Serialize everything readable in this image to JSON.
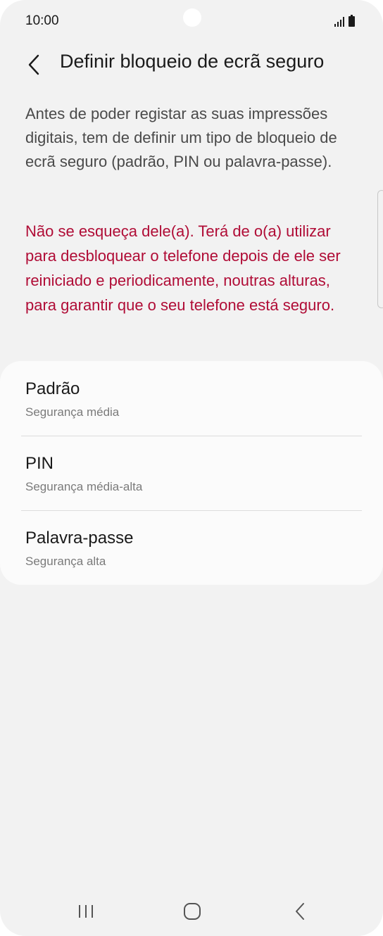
{
  "status_bar": {
    "time": "10:00",
    "signal_icon": "signal-icon",
    "battery_icon": "battery-icon"
  },
  "header": {
    "back_icon": "chevron-left-icon",
    "title": "Definir bloqueio de ecrã seguro"
  },
  "description": "Antes de poder registar as suas impressões digitais, tem de definir um tipo de bloqueio de ecrã seguro (padrão, PIN ou palavra-passe).",
  "warning": "Não se esqueça dele(a). Terá de o(a) utilizar para desbloquear o telefone depois de ele ser reiniciado e periodicamente, noutras alturas, para garantir que o seu telefone está seguro.",
  "options": [
    {
      "title": "Padrão",
      "subtitle": "Segurança média"
    },
    {
      "title": "PIN",
      "subtitle": "Segurança média-alta"
    },
    {
      "title": "Palavra-passe",
      "subtitle": "Segurança alta"
    }
  ],
  "nav_bar": {
    "recents_icon": "recents-icon",
    "home_icon": "home-icon",
    "back_icon": "back-icon"
  },
  "colors": {
    "background": "#f2f2f2",
    "card": "#fbfbfb",
    "warning_text": "#b00c36",
    "primary_text": "#1a1a1a",
    "secondary_text": "#7a7a7a"
  }
}
